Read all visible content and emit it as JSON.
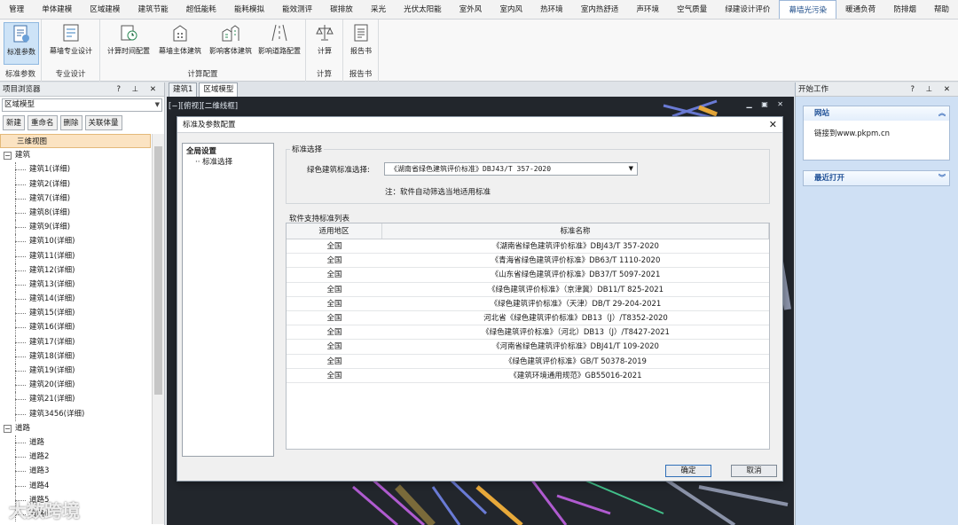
{
  "menu": [
    "管理",
    "单体建模",
    "区域建模",
    "建筑节能",
    "超低能耗",
    "能耗模拟",
    "能效测评",
    "碳排放",
    "采光",
    "光伏太阳能",
    "室外风",
    "室内风",
    "热环境",
    "室内热舒适",
    "声环境",
    "空气质量",
    "绿建设计评价",
    "幕墙光污染",
    "暖通负荷",
    "防排烟",
    "帮助"
  ],
  "menu_active_index": 17,
  "ribbon": {
    "groups": [
      {
        "label": "标准参数",
        "buttons": [
          {
            "label": "标准参数",
            "icon": "standard-params-icon",
            "selected": true
          }
        ]
      },
      {
        "label": "专业设计",
        "buttons": [
          {
            "label": "幕墙专业设计",
            "icon": "curtain-design-icon"
          }
        ]
      },
      {
        "label": "计算配置",
        "buttons": [
          {
            "label": "计算时间配置",
            "icon": "time-config-icon"
          },
          {
            "label": "幕墙主体建筑",
            "icon": "main-building-icon"
          },
          {
            "label": "影响客体建筑",
            "icon": "affected-building-icon"
          },
          {
            "label": "影响道路配置",
            "icon": "road-config-icon"
          }
        ]
      },
      {
        "label": "计算",
        "buttons": [
          {
            "label": "计算",
            "icon": "calculate-icon"
          }
        ]
      },
      {
        "label": "报告书",
        "buttons": [
          {
            "label": "报告书",
            "icon": "report-icon"
          }
        ]
      }
    ]
  },
  "left_panel": {
    "title": "项目浏览器",
    "controls": "? ⊥ ✕",
    "combo_value": "区域模型",
    "buttons": [
      "新建",
      "重命名",
      "删除",
      "关联体量"
    ],
    "tree": [
      {
        "label": "三维视图",
        "level": 1,
        "selected": true
      },
      {
        "label": "建筑",
        "level": 1,
        "toggle": "−"
      },
      {
        "label": "建筑1(详细)",
        "level": 2
      },
      {
        "label": "建筑2(详细)",
        "level": 2
      },
      {
        "label": "建筑7(详细)",
        "level": 2
      },
      {
        "label": "建筑8(详细)",
        "level": 2
      },
      {
        "label": "建筑9(详细)",
        "level": 2
      },
      {
        "label": "建筑10(详细)",
        "level": 2
      },
      {
        "label": "建筑11(详细)",
        "level": 2
      },
      {
        "label": "建筑12(详细)",
        "level": 2
      },
      {
        "label": "建筑13(详细)",
        "level": 2
      },
      {
        "label": "建筑14(详细)",
        "level": 2
      },
      {
        "label": "建筑15(详细)",
        "level": 2
      },
      {
        "label": "建筑16(详细)",
        "level": 2
      },
      {
        "label": "建筑17(详细)",
        "level": 2
      },
      {
        "label": "建筑18(详细)",
        "level": 2
      },
      {
        "label": "建筑19(详细)",
        "level": 2
      },
      {
        "label": "建筑20(详细)",
        "level": 2
      },
      {
        "label": "建筑21(详细)",
        "level": 2
      },
      {
        "label": "建筑3456(详细)",
        "level": 2
      },
      {
        "label": "道路",
        "level": 1,
        "toggle": "−"
      },
      {
        "label": "道路",
        "level": 2
      },
      {
        "label": "道路2",
        "level": 2
      },
      {
        "label": "道路3",
        "level": 2
      },
      {
        "label": "道路4",
        "level": 2
      },
      {
        "label": "道路5",
        "level": 2
      },
      {
        "label": "道路6",
        "level": 2
      }
    ]
  },
  "view_tabs": [
    "建筑1",
    "区域模型"
  ],
  "view_tab_active": 1,
  "viewport_label": "[−][俯视][二维线框]",
  "right_panel": {
    "title": "开始工作",
    "controls": "? ⊥ ✕",
    "website_title": "网站",
    "website_link": "链接到www.pkpm.cn",
    "recent_title": "最近打开"
  },
  "dialog": {
    "title": "标准及参数配置",
    "tree_root": "全局设置",
    "tree_child": "标准选择",
    "group1_title": "标准选择",
    "select_label": "绿色建筑标准选择:",
    "select_value": "《湖南省绿色建筑评价标准》DBJ43/T 357-2020",
    "note": "注：软件自动筛选当地适用标准",
    "group2_title": "软件支持标准列表",
    "col_region": "适用地区",
    "col_name": "标准名称",
    "rows": [
      {
        "region": "全国",
        "name": "《湖南省绿色建筑评价标准》DBJ43/T 357-2020"
      },
      {
        "region": "全国",
        "name": "《青海省绿色建筑评价标准》DB63/T 1110-2020"
      },
      {
        "region": "全国",
        "name": "《山东省绿色建筑评价标准》DB37/T 5097-2021"
      },
      {
        "region": "全国",
        "name": "《绿色建筑评价标准》（京津冀）DB11/T 825-2021"
      },
      {
        "region": "全国",
        "name": "《绿色建筑评价标准》（天津）DB/T 29-204-2021"
      },
      {
        "region": "全国",
        "name": "河北省《绿色建筑评价标准》DB13（J）/T8352-2020"
      },
      {
        "region": "全国",
        "name": "《绿色建筑评价标准》（河北）DB13（J）/T8427-2021"
      },
      {
        "region": "全国",
        "name": "《河南省绿色建筑评价标准》DBJ41/T 109-2020"
      },
      {
        "region": "全国",
        "name": "《绿色建筑评价标准》GB/T 50378-2019"
      },
      {
        "region": "全国",
        "name": "《建筑环境通用规范》GB55016-2021"
      }
    ],
    "ok_label": "确定",
    "cancel_label": "取消"
  },
  "watermark": "大数跨境"
}
